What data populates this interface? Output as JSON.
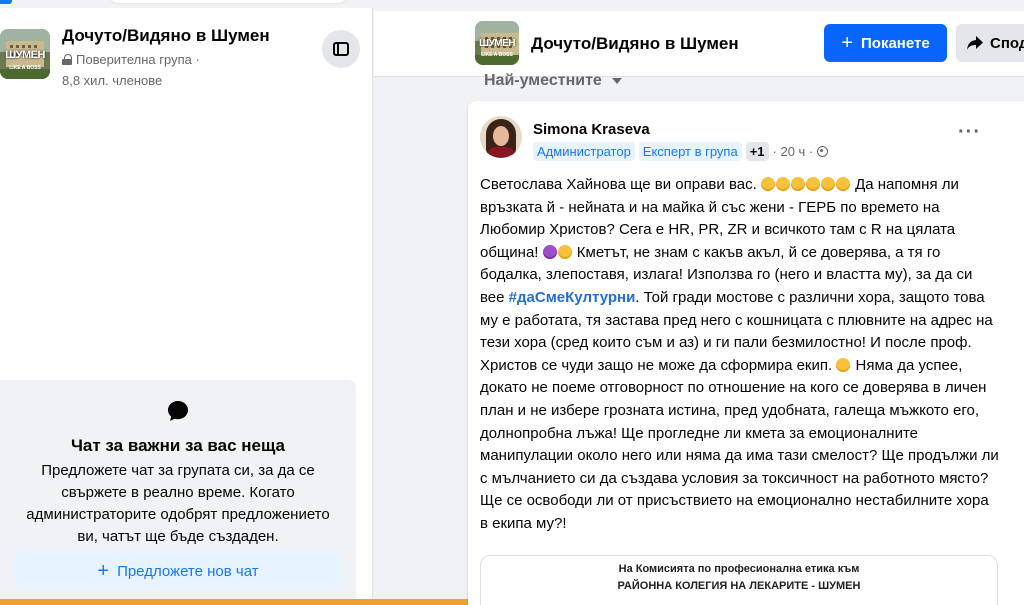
{
  "group": {
    "name": "Дочуто/Видяно в Шумен",
    "privacy": "Поверителна група ·",
    "members": "8,8 хил. членове",
    "thumb_text": "ШУМЕН",
    "thumb_sub": "LIKE A BOSS"
  },
  "chat": {
    "title": "Чат за важни за вас неща",
    "description": "Предложете чат за групата си, за да се свържете в реално време. Когато администраторите одобрят предложението ви, чатът ще бъде създаден.",
    "button_label": "Предложете нов чат"
  },
  "header": {
    "invite_label": "Поканете",
    "share_label": "Спод"
  },
  "feed": {
    "sort_label": "Най-уместните"
  },
  "post": {
    "author": "Simona Kraseva",
    "badge_admin": "Администратор",
    "badge_expert": "Експерт в група",
    "badge_more": "+1",
    "time": "· 20 ч ·",
    "more": "···",
    "text_p1": "Светослава Хайнова ще ви оправи вас.",
    "text_p2": "Да напомня ли връзката й - нейната и на майка й със жени - ГЕРБ по времето на Любомир Христов? Сега е HR, PR, ZR и всичкото там с R на цялата община!",
    "text_p3": "Кметът, не знам с какъв акъл, й се доверява, а тя го бодалка, злепоставя, излага! Използва го (него и властта му), за да си вее",
    "hashtag": "#даСмеКултурни",
    "text_p4": ". Той гради мостове с различни хора, защото това му е работата, тя застава пред него с кошницата с плювните на адрес на тези хора (сред които съм и аз) и ги пали безмилостно! И после проф. Христов се чуди защо не може да сформира екип.",
    "text_p5": "Няма да успее, докато не поеме отговорност по отношение на кого се доверява в личен план и не избере грозната истина, пред удобната, галеща мъжкото его, долнопробна лъжа! Ще прогледне ли кмета за емоционалните манипулации около него или няма да има тази смелост? Ще продължи ли с мълчанието си да създава условия за токсичност на работното място? Ще се освободи ли от присъствието на емоционално нестабилните хора в екипа му?!",
    "doc_line1": "На Комисията по професионална етика към",
    "doc_line2": "РАЙОННА КОЛЕГИЯ НА ЛЕКАРИТЕ - ШУМЕН"
  },
  "colors": {
    "accent": "#0866ff",
    "link": "#216fdb",
    "secondary_text": "#65676b",
    "background": "#f0f2f5"
  }
}
